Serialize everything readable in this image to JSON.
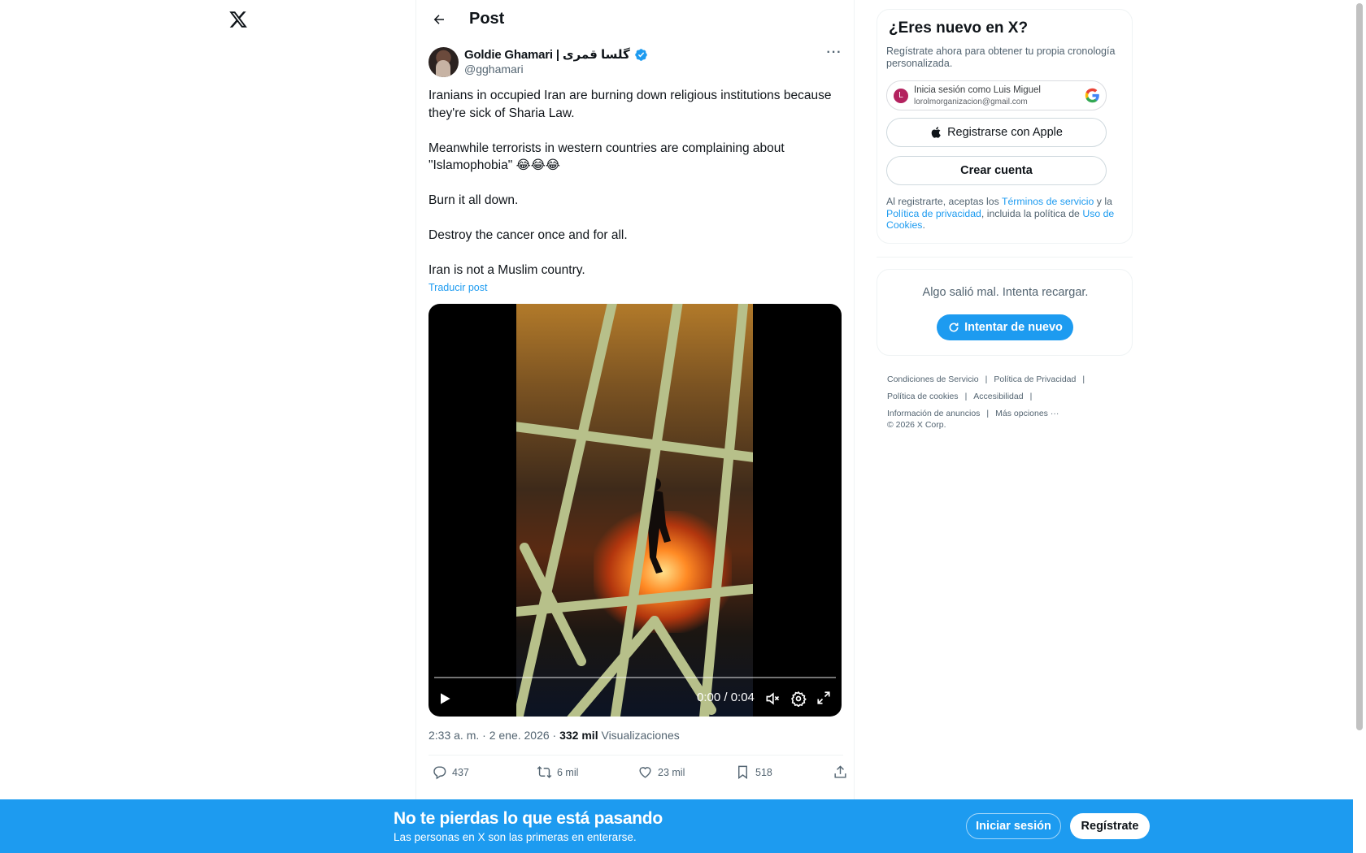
{
  "header": {
    "title": "Post"
  },
  "post": {
    "author_name": "Goldie Ghamari | گلسا قمری",
    "author_handle": "@gghamari",
    "more_label": "···",
    "text_paragraphs": [
      "Iranians in occupied Iran are burning down religious institutions because they're sick of Sharia Law.",
      "Meanwhile terrorists in western countries are complaining about \"Islamophobia\" 😂😂😂",
      "Burn it all down.",
      "Destroy the cancer once and for all.",
      "Iran is not a Muslim country."
    ],
    "translate_label": "Traducir post",
    "video": {
      "time": "0:00 / 0:04",
      "progress": 0
    },
    "timestamp": "2:33 a. m. · 2 ene. 2026 · ",
    "views_count": "332 mil",
    "views_label": " Visualizaciones",
    "actions": {
      "replies": "437",
      "reposts": "6 mil",
      "likes": "23 mil",
      "bookmarks": "518"
    }
  },
  "signup": {
    "title": "¿Eres nuevo en X?",
    "subtitle": "Regístrate ahora para obtener tu propia cronología personalizada.",
    "google": {
      "initial": "L",
      "line1": "Inicia sesión como Luis Miguel",
      "line2": "lorolmorganizacion@gmail.com"
    },
    "apple_label": "Registrarse con Apple",
    "create_label": "Crear cuenta",
    "terms": {
      "t1": "Al registrarte, aceptas los ",
      "link1": "Términos de servicio",
      "t2": " y la ",
      "link2": "Política de privacidad",
      "t3": ", incluida la política de ",
      "link3": "Uso de Cookies",
      "t4": "."
    }
  },
  "error_card": {
    "message": "Algo salió mal. Intenta recargar.",
    "retry_label": "Intentar de nuevo"
  },
  "footer": {
    "links": [
      "Condiciones de Servicio",
      "Política de Privacidad",
      "Política de cookies",
      "Accesibilidad",
      "Información de anuncios",
      "Más opciones ···"
    ],
    "copyright": "© 2026 X Corp."
  },
  "banner": {
    "title": "No te pierdas lo que está pasando",
    "subtitle": "Las personas en X son las primeras en enterarse.",
    "login_label": "Iniciar sesión",
    "register_label": "Regístrate"
  },
  "colors": {
    "accent": "#1d9bf0",
    "text": "#0f1419",
    "muted": "#536471"
  }
}
